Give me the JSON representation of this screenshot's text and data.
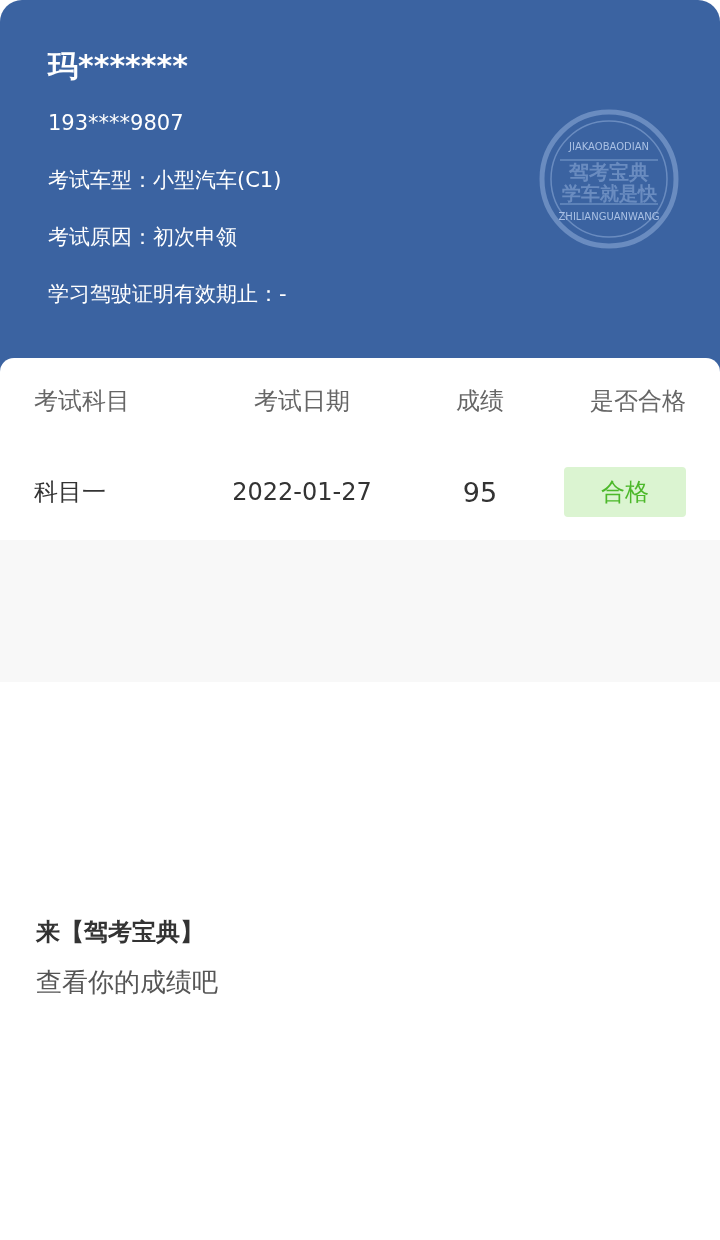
{
  "profile": {
    "name": "玛*******",
    "phone": "193****9807",
    "fields": [
      {
        "label": "考试车型：",
        "value": "小型汽车(C1)"
      },
      {
        "label": "考试原因：",
        "value": "初次申领"
      },
      {
        "label": "学习驾驶证明有效期止：",
        "value": "-"
      }
    ],
    "stamp": {
      "top": "JIAKAOBAODIAN",
      "line_1": "驾考宝典",
      "line_2": "学车就是快",
      "bottom": "ZHILIANGUANWANG"
    }
  },
  "table": {
    "columns": [
      "考试科目",
      "考试日期",
      "成绩",
      "是否合格"
    ],
    "rows": [
      {
        "subject": "科目一",
        "date": "2022-01-27",
        "score": "95",
        "result": "合格",
        "passed": true
      }
    ]
  },
  "footer": {
    "title": "来【驾考宝典】",
    "subtitle": "查看你的成绩吧"
  }
}
